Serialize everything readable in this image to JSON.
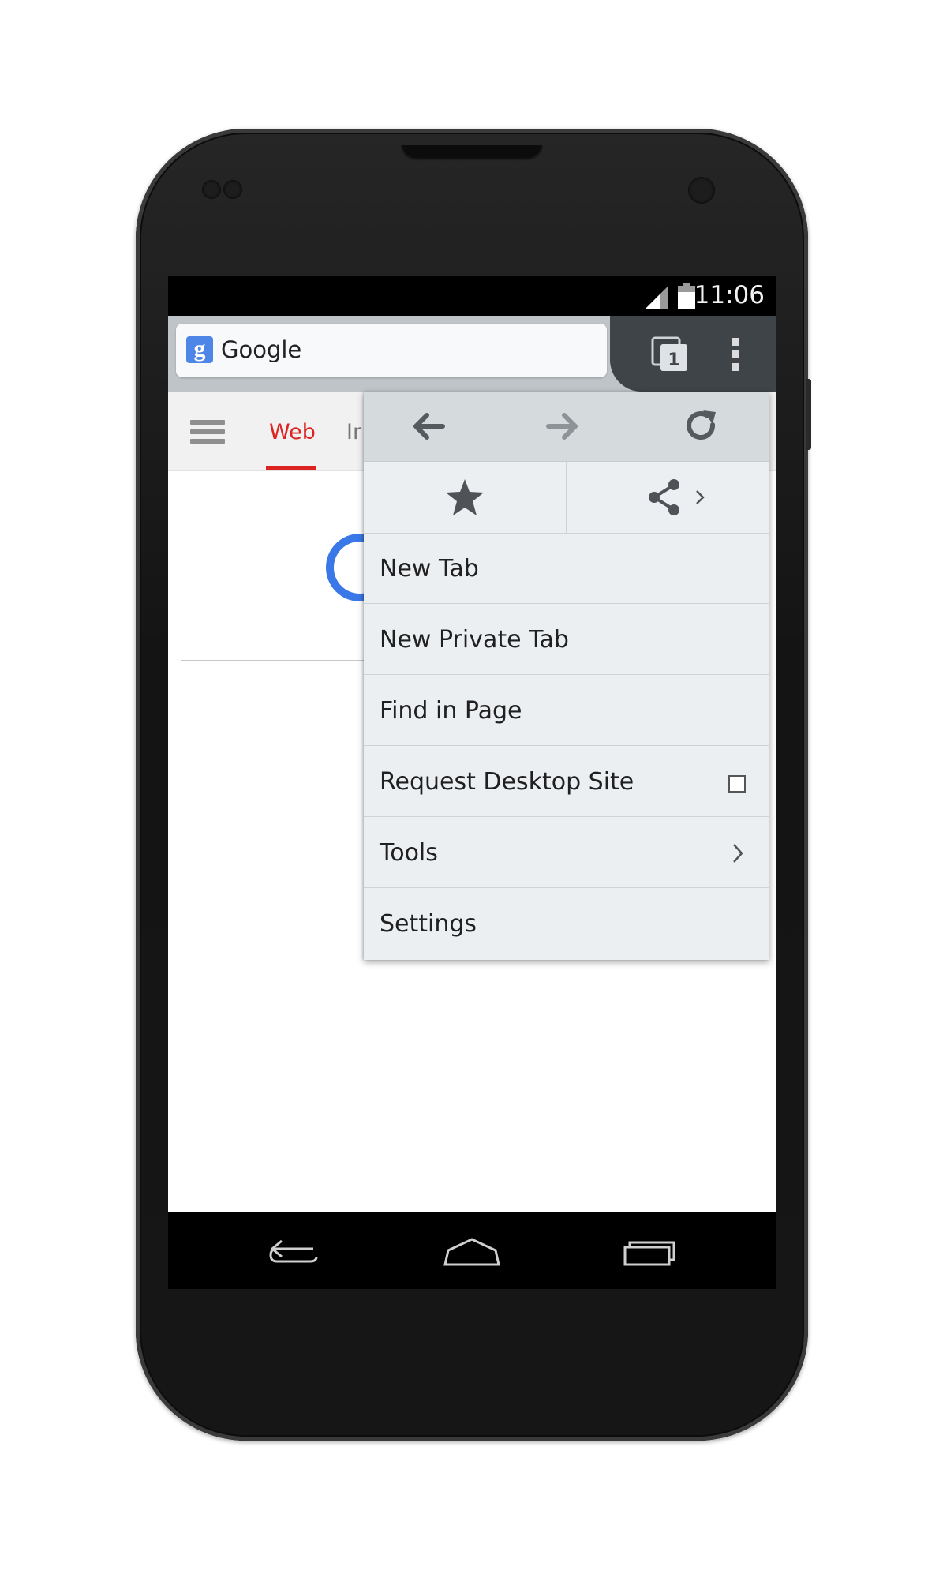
{
  "status_bar": {
    "time": "11:06",
    "signal_icon": "signal-icon",
    "battery_icon": "battery-icon"
  },
  "browser_toolbar": {
    "url_text": "Google",
    "favicon_letter": "g",
    "tab_count": "1",
    "icons": [
      "tabs-switcher-icon",
      "overflow-menu-icon"
    ]
  },
  "page": {
    "nav_tabs": [
      {
        "label": "Web",
        "active": true
      },
      {
        "label": "Ir",
        "active": false
      }
    ],
    "menu_icon": "hamburger-icon"
  },
  "menu": {
    "nav_icons": [
      "back-arrow-icon",
      "forward-arrow-icon",
      "reload-icon"
    ],
    "action_icons": [
      "bookmark-star-icon",
      "share-icon"
    ],
    "items": [
      {
        "label": "New Tab"
      },
      {
        "label": "New Private Tab"
      },
      {
        "label": "Find in Page"
      },
      {
        "label": "Request Desktop Site",
        "checkbox": false
      },
      {
        "label": "Tools",
        "submenu": true
      },
      {
        "label": "Settings"
      }
    ]
  },
  "system_nav": [
    "back-icon",
    "home-icon",
    "recents-icon"
  ],
  "colors": {
    "accent_red": "#dd2222",
    "menu_bg": "#eceff2",
    "toolbar_dark": "#3e4448",
    "google_blue": "#3b78e7"
  }
}
